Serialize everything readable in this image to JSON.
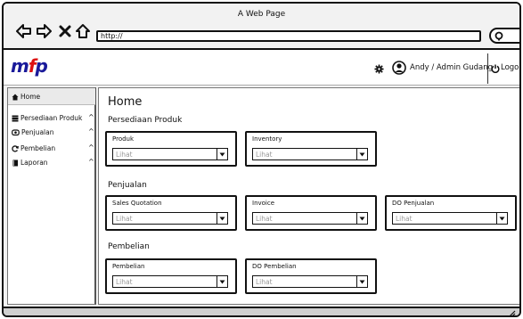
{
  "window": {
    "title": "A Web Page",
    "url": "http://"
  },
  "header": {
    "logo_main": "m",
    "logo_accent": "f",
    "logo_end": "p",
    "user": "Andy / Admin Gudang",
    "logout": "Logout"
  },
  "sidebar": {
    "items": [
      {
        "label": "Home",
        "icon": "home-icon"
      },
      {
        "label": "Persediaan Produk",
        "icon": "stack-icon"
      },
      {
        "label": "Penjualan",
        "icon": "sales-icon"
      },
      {
        "label": "Pembelian",
        "icon": "refresh-icon"
      },
      {
        "label": "Laporan",
        "icon": "book-icon"
      }
    ]
  },
  "main": {
    "title": "Home",
    "sections": [
      {
        "title": "Persediaan Produk",
        "cards": [
          {
            "label": "Produk",
            "value": "Lihat"
          },
          {
            "label": "Inventory",
            "value": "Lihat"
          }
        ]
      },
      {
        "title": "Penjualan",
        "cards": [
          {
            "label": "Sales Quotation",
            "value": "Lihat"
          },
          {
            "label": "Invoice",
            "value": "Lihat"
          },
          {
            "label": "DO Penjualan",
            "value": "Lihat"
          }
        ]
      },
      {
        "title": "Pembelian",
        "cards": [
          {
            "label": "Pembelian",
            "value": "Lihat"
          },
          {
            "label": "DO Pembelian",
            "value": "Lihat"
          }
        ]
      }
    ]
  },
  "colors": {
    "logo_blue": "#1a1a9a",
    "logo_red": "#dd1111"
  }
}
